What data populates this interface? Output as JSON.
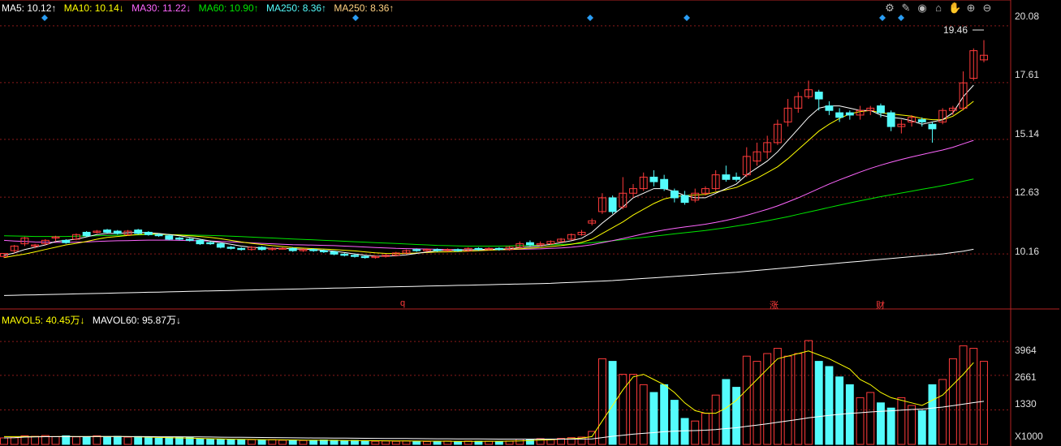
{
  "colors": {
    "up": "#ff3b3b",
    "down": "#54fcfc",
    "ma5": "#ffffff",
    "ma10": "#ffff00",
    "ma30": "#ff66ff",
    "ma60": "#00e600",
    "ma250": "#ffffff",
    "grid": "#8b1a1a",
    "axis": "#b22222",
    "vol_ma5": "#ffff00",
    "vol_ma60": "#ffffff"
  },
  "legend": {
    "ma5": "MA5: 10.12↑",
    "ma10": "MA10: 10.14↓",
    "ma30": "MA30: 11.22↓",
    "ma60": "MA60: 10.90↑",
    "ma250a": "MA250: 8.36↑",
    "ma250b": "MA250: 8.36↑"
  },
  "vol_legend": {
    "mavol5": "MAVOL5: 40.45万↓",
    "mavol60": "MAVOL60: 95.87万↓"
  },
  "toolbar_icons": [
    "settings-icon",
    "pen-icon",
    "eye-icon",
    "store-icon",
    "hand-icon",
    "zoom-in-icon",
    "zoom-out-icon"
  ],
  "price_axis": {
    "labels": [
      "20.08",
      "17.61",
      "15.14",
      "12.63",
      "10.16"
    ]
  },
  "vol_axis": {
    "labels": [
      "3964",
      "2661",
      "1330"
    ],
    "unit": "X1000"
  },
  "high_label": "19.46",
  "markers": [
    {
      "text": "q",
      "x": 495
    },
    {
      "text": "涨",
      "x": 952
    },
    {
      "text": "财",
      "x": 1082
    }
  ],
  "chart_data": {
    "type": "candlestick",
    "ylim": [
      7.8,
      20.5
    ],
    "vol_ylim": [
      0,
      4000
    ],
    "candles": [
      [
        10.05,
        10.18,
        10.2,
        9.98
      ],
      [
        10.3,
        10.5,
        10.55,
        10.2
      ],
      [
        10.6,
        10.85,
        10.9,
        10.5
      ],
      [
        10.5,
        10.55,
        10.6,
        10.4
      ],
      [
        10.6,
        10.75,
        10.8,
        10.55
      ],
      [
        10.85,
        10.9,
        10.95,
        10.7
      ],
      [
        10.75,
        10.65,
        10.8,
        10.6
      ],
      [
        10.8,
        11.0,
        11.05,
        10.75
      ],
      [
        11.1,
        10.95,
        11.15,
        10.9
      ],
      [
        11.1,
        11.15,
        11.2,
        11.05
      ],
      [
        11.2,
        11.1,
        11.25,
        11.05
      ],
      [
        11.15,
        11.05,
        11.2,
        11.0
      ],
      [
        11.0,
        11.15,
        11.2,
        10.95
      ],
      [
        11.2,
        11.05,
        11.25,
        11.0
      ],
      [
        11.1,
        11.0,
        11.15,
        10.95
      ],
      [
        11.0,
        10.95,
        11.05,
        10.9
      ],
      [
        10.95,
        10.8,
        11.0,
        10.75
      ],
      [
        10.85,
        10.8,
        10.9,
        10.75
      ],
      [
        10.8,
        10.75,
        10.85,
        10.7
      ],
      [
        10.75,
        10.6,
        10.8,
        10.55
      ],
      [
        10.65,
        10.6,
        10.7,
        10.55
      ],
      [
        10.6,
        10.45,
        10.65,
        10.4
      ],
      [
        10.45,
        10.4,
        10.5,
        10.35
      ],
      [
        10.4,
        10.35,
        10.45,
        10.3
      ],
      [
        10.35,
        10.45,
        10.5,
        10.3
      ],
      [
        10.45,
        10.35,
        10.5,
        10.3
      ],
      [
        10.35,
        10.4,
        10.45,
        10.3
      ],
      [
        10.4,
        10.4,
        10.45,
        10.35
      ],
      [
        10.4,
        10.3,
        10.45,
        10.25
      ],
      [
        10.3,
        10.35,
        10.4,
        10.25
      ],
      [
        10.35,
        10.3,
        10.4,
        10.25
      ],
      [
        10.3,
        10.25,
        10.35,
        10.2
      ],
      [
        10.25,
        10.15,
        10.3,
        10.1
      ],
      [
        10.15,
        10.1,
        10.2,
        10.05
      ],
      [
        10.1,
        10.05,
        10.15,
        10.0
      ],
      [
        10.05,
        10.0,
        10.1,
        9.95
      ],
      [
        10.0,
        10.05,
        10.1,
        9.95
      ],
      [
        10.05,
        10.1,
        10.15,
        10.0
      ],
      [
        10.1,
        10.2,
        10.25,
        10.05
      ],
      [
        10.2,
        10.3,
        10.35,
        10.15
      ],
      [
        10.35,
        10.3,
        10.4,
        10.25
      ],
      [
        10.3,
        10.35,
        10.4,
        10.25
      ],
      [
        10.35,
        10.3,
        10.4,
        10.25
      ],
      [
        10.3,
        10.35,
        10.4,
        10.25
      ],
      [
        10.35,
        10.3,
        10.4,
        10.25
      ],
      [
        10.3,
        10.4,
        10.45,
        10.25
      ],
      [
        10.4,
        10.35,
        10.45,
        10.3
      ],
      [
        10.35,
        10.4,
        10.45,
        10.3
      ],
      [
        10.4,
        10.35,
        10.45,
        10.3
      ],
      [
        10.35,
        10.45,
        10.5,
        10.3
      ],
      [
        10.45,
        10.6,
        10.7,
        10.4
      ],
      [
        10.65,
        10.55,
        10.75,
        10.5
      ],
      [
        10.55,
        10.6,
        10.7,
        10.5
      ],
      [
        10.6,
        10.7,
        10.75,
        10.55
      ],
      [
        10.7,
        10.8,
        10.85,
        10.65
      ],
      [
        10.8,
        11.0,
        11.05,
        10.75
      ],
      [
        11.0,
        11.1,
        11.2,
        10.95
      ],
      [
        11.5,
        11.6,
        11.7,
        11.4
      ],
      [
        12.0,
        12.6,
        12.8,
        11.9
      ],
      [
        12.6,
        12.0,
        12.7,
        11.9
      ],
      [
        12.2,
        12.8,
        13.5,
        12.1
      ],
      [
        12.8,
        13.0,
        13.2,
        12.6
      ],
      [
        13.0,
        13.5,
        13.7,
        12.9
      ],
      [
        13.5,
        13.3,
        13.8,
        13.1
      ],
      [
        13.4,
        13.0,
        13.6,
        12.9
      ],
      [
        12.9,
        12.6,
        13.0,
        12.4
      ],
      [
        12.7,
        12.4,
        12.9,
        12.3
      ],
      [
        12.5,
        12.8,
        13.0,
        12.4
      ],
      [
        12.8,
        13.0,
        13.1,
        12.7
      ],
      [
        13.0,
        13.6,
        13.8,
        12.9
      ],
      [
        13.6,
        13.4,
        14.0,
        13.3
      ],
      [
        13.5,
        13.4,
        13.7,
        13.3
      ],
      [
        13.6,
        14.4,
        14.8,
        13.5
      ],
      [
        14.2,
        14.6,
        15.0,
        14.0
      ],
      [
        14.6,
        15.0,
        15.3,
        14.3
      ],
      [
        15.0,
        15.8,
        16.0,
        14.9
      ],
      [
        15.9,
        16.5,
        16.9,
        15.7
      ],
      [
        16.5,
        17.0,
        17.2,
        16.3
      ],
      [
        17.0,
        17.3,
        17.7,
        16.9
      ],
      [
        17.2,
        16.9,
        17.3,
        16.4
      ],
      [
        16.6,
        16.4,
        16.8,
        16.2
      ],
      [
        16.3,
        16.1,
        16.5,
        15.9
      ],
      [
        16.3,
        16.2,
        16.4,
        16.0
      ],
      [
        16.2,
        16.4,
        16.6,
        16.0
      ],
      [
        16.4,
        16.5,
        16.6,
        16.2
      ],
      [
        16.6,
        16.3,
        16.7,
        16.1
      ],
      [
        16.3,
        15.7,
        16.4,
        15.5
      ],
      [
        15.7,
        15.8,
        16.0,
        15.4
      ],
      [
        15.9,
        16.1,
        16.2,
        15.7
      ],
      [
        16.0,
        15.9,
        16.1,
        15.7
      ],
      [
        15.8,
        15.6,
        15.9,
        15.0
      ],
      [
        15.9,
        16.4,
        16.5,
        15.8
      ],
      [
        16.4,
        16.5,
        16.6,
        16.2
      ],
      [
        16.5,
        17.6,
        18.1,
        16.4
      ],
      [
        17.8,
        19.0,
        19.1,
        17.7
      ],
      [
        18.6,
        18.8,
        19.46,
        18.5
      ]
    ],
    "ma5": [
      10.1,
      10.2,
      10.35,
      10.45,
      10.55,
      10.7,
      10.75,
      10.8,
      10.9,
      11.0,
      11.05,
      11.05,
      11.08,
      11.1,
      11.08,
      11.05,
      11.0,
      10.95,
      10.88,
      10.8,
      10.72,
      10.65,
      10.58,
      10.5,
      10.45,
      10.42,
      10.4,
      10.4,
      10.38,
      10.36,
      10.35,
      10.32,
      10.28,
      10.22,
      10.16,
      10.1,
      10.07,
      10.06,
      10.08,
      10.12,
      10.18,
      10.24,
      10.3,
      10.32,
      10.32,
      10.34,
      10.35,
      10.36,
      10.37,
      10.38,
      10.43,
      10.47,
      10.51,
      10.58,
      10.65,
      10.73,
      10.84,
      11.1,
      11.5,
      11.85,
      12.2,
      12.6,
      12.8,
      13.0,
      13.0,
      12.88,
      12.7,
      12.6,
      12.6,
      12.8,
      13.0,
      13.2,
      13.6,
      13.9,
      14.2,
      14.6,
      15.1,
      15.6,
      16.1,
      16.5,
      16.6,
      16.6,
      16.5,
      16.4,
      16.4,
      16.2,
      16.1,
      16.05,
      15.95,
      15.8,
      15.9,
      16.0,
      16.3,
      17.0,
      17.5
    ],
    "ma10": [
      10.0,
      10.08,
      10.15,
      10.25,
      10.35,
      10.45,
      10.55,
      10.62,
      10.7,
      10.8,
      10.88,
      10.92,
      10.96,
      11.0,
      11.02,
      11.02,
      11.0,
      10.98,
      10.95,
      10.92,
      10.88,
      10.82,
      10.75,
      10.68,
      10.62,
      10.57,
      10.52,
      10.48,
      10.44,
      10.41,
      10.39,
      10.37,
      10.35,
      10.32,
      10.29,
      10.25,
      10.21,
      10.18,
      10.17,
      10.18,
      10.2,
      10.22,
      10.24,
      10.25,
      10.26,
      10.28,
      10.3,
      10.32,
      10.34,
      10.35,
      10.38,
      10.41,
      10.44,
      10.48,
      10.52,
      10.58,
      10.66,
      10.8,
      11.05,
      11.3,
      11.55,
      11.85,
      12.1,
      12.35,
      12.55,
      12.65,
      12.7,
      12.72,
      12.75,
      12.85,
      12.95,
      13.05,
      13.25,
      13.45,
      13.7,
      13.95,
      14.3,
      14.7,
      15.1,
      15.5,
      15.8,
      16.05,
      16.25,
      16.35,
      16.4,
      16.3,
      16.25,
      16.2,
      16.15,
      16.05,
      16.0,
      16.0,
      16.15,
      16.45,
      16.8
    ],
    "ma30": [
      10.75,
      10.72,
      10.7,
      10.68,
      10.67,
      10.66,
      10.66,
      10.67,
      10.68,
      10.7,
      10.72,
      10.73,
      10.74,
      10.75,
      10.76,
      10.76,
      10.76,
      10.75,
      10.74,
      10.73,
      10.72,
      10.7,
      10.68,
      10.66,
      10.64,
      10.62,
      10.6,
      10.58,
      10.56,
      10.55,
      10.54,
      10.53,
      10.52,
      10.5,
      10.48,
      10.46,
      10.44,
      10.42,
      10.4,
      10.39,
      10.38,
      10.37,
      10.36,
      10.35,
      10.34,
      10.34,
      10.34,
      10.34,
      10.34,
      10.35,
      10.36,
      10.37,
      10.38,
      10.4,
      10.42,
      10.45,
      10.5,
      10.56,
      10.65,
      10.74,
      10.83,
      10.93,
      11.03,
      11.12,
      11.2,
      11.27,
      11.33,
      11.39,
      11.45,
      11.53,
      11.62,
      11.72,
      11.84,
      11.97,
      12.1,
      12.25,
      12.42,
      12.6,
      12.8,
      13.0,
      13.2,
      13.38,
      13.55,
      13.72,
      13.88,
      14.02,
      14.15,
      14.27,
      14.38,
      14.48,
      14.58,
      14.68,
      14.8,
      14.95,
      15.1
    ],
    "ma60": [
      10.95,
      10.94,
      10.93,
      10.92,
      10.92,
      10.92,
      10.92,
      10.93,
      10.94,
      10.95,
      10.96,
      10.97,
      10.98,
      10.99,
      11.0,
      11.0,
      11.0,
      10.99,
      10.98,
      10.97,
      10.96,
      10.95,
      10.93,
      10.91,
      10.89,
      10.87,
      10.85,
      10.83,
      10.81,
      10.79,
      10.77,
      10.75,
      10.73,
      10.71,
      10.69,
      10.67,
      10.65,
      10.63,
      10.61,
      10.59,
      10.57,
      10.55,
      10.53,
      10.52,
      10.51,
      10.5,
      10.5,
      10.5,
      10.5,
      10.51,
      10.52,
      10.53,
      10.54,
      10.55,
      10.57,
      10.59,
      10.62,
      10.65,
      10.69,
      10.73,
      10.78,
      10.83,
      10.88,
      10.93,
      10.98,
      11.03,
      11.08,
      11.13,
      11.18,
      11.24,
      11.3,
      11.37,
      11.44,
      11.52,
      11.6,
      11.69,
      11.78,
      11.88,
      11.98,
      12.08,
      12.18,
      12.28,
      12.38,
      12.47,
      12.56,
      12.65,
      12.73,
      12.81,
      12.89,
      12.97,
      13.05,
      13.13,
      13.22,
      13.32,
      13.42
    ],
    "ma250": [
      8.35,
      8.36,
      8.37,
      8.38,
      8.39,
      8.4,
      8.41,
      8.42,
      8.43,
      8.44,
      8.45,
      8.46,
      8.47,
      8.48,
      8.49,
      8.5,
      8.51,
      8.52,
      8.53,
      8.54,
      8.55,
      8.56,
      8.57,
      8.58,
      8.59,
      8.6,
      8.61,
      8.62,
      8.63,
      8.64,
      8.65,
      8.66,
      8.67,
      8.68,
      8.69,
      8.7,
      8.71,
      8.72,
      8.73,
      8.74,
      8.75,
      8.76,
      8.77,
      8.78,
      8.79,
      8.8,
      8.81,
      8.82,
      8.83,
      8.84,
      8.85,
      8.86,
      8.87,
      8.88,
      8.9,
      8.92,
      8.94,
      8.96,
      8.98,
      9.0,
      9.03,
      9.06,
      9.09,
      9.12,
      9.15,
      9.18,
      9.21,
      9.24,
      9.27,
      9.3,
      9.33,
      9.36,
      9.4,
      9.44,
      9.48,
      9.52,
      9.56,
      9.6,
      9.64,
      9.68,
      9.72,
      9.76,
      9.8,
      9.84,
      9.88,
      9.92,
      9.96,
      10.0,
      10.04,
      10.08,
      10.12,
      10.16,
      10.22,
      10.28,
      10.36
    ],
    "volumes": [
      250,
      260,
      330,
      310,
      340,
      300,
      330,
      290,
      290,
      330,
      290,
      310,
      280,
      300,
      270,
      240,
      270,
      270,
      270,
      220,
      200,
      200,
      190,
      180,
      180,
      170,
      180,
      160,
      170,
      150,
      160,
      170,
      160,
      140,
      150,
      140,
      120,
      130,
      120,
      130,
      120,
      110,
      110,
      130,
      110,
      130,
      120,
      120,
      110,
      130,
      200,
      180,
      220,
      180,
      230,
      260,
      280,
      500,
      3300,
      3200,
      2700,
      2700,
      2300,
      2000,
      2300,
      1700,
      1000,
      900,
      1200,
      1900,
      2500,
      2200,
      3400,
      3200,
      3500,
      3700,
      3400,
      3500,
      4000,
      3200,
      3000,
      2600,
      2300,
      1800,
      2000,
      1600,
      1400,
      1800,
      1500,
      1300,
      2300,
      2500,
      3300,
      3800,
      3700,
      3200
    ],
    "vol_ma5": [
      300,
      300,
      300,
      300,
      300,
      300,
      300,
      300,
      300,
      300,
      300,
      300,
      300,
      290,
      280,
      270,
      260,
      250,
      240,
      230,
      220,
      210,
      200,
      195,
      190,
      185,
      180,
      175,
      170,
      165,
      160,
      158,
      156,
      152,
      148,
      145,
      140,
      136,
      132,
      130,
      128,
      126,
      124,
      122,
      120,
      120,
      120,
      121,
      122,
      125,
      135,
      148,
      162,
      180,
      202,
      220,
      240,
      300,
      900,
      1500,
      2100,
      2600,
      2700,
      2500,
      2300,
      2000,
      1600,
      1300,
      1200,
      1200,
      1400,
      1700,
      2100,
      2500,
      2900,
      3300,
      3400,
      3500,
      3600,
      3450,
      3300,
      3100,
      2900,
      2500,
      2300,
      2000,
      1800,
      1700,
      1600,
      1500,
      1700,
      1900,
      2300,
      2700,
      3150
    ]
  }
}
